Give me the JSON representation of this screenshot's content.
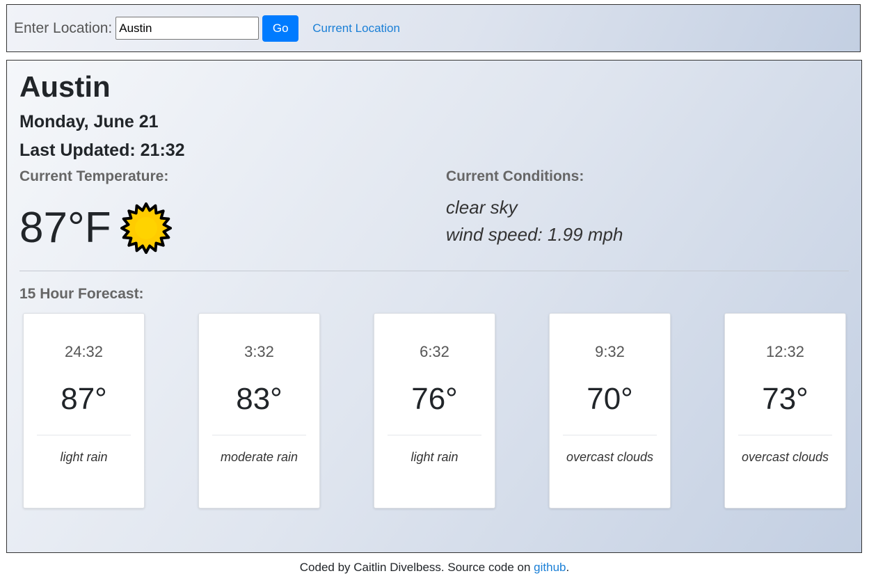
{
  "search": {
    "label": "Enter Location:",
    "value": "Austin",
    "go_label": "Go",
    "current_location_label": "Current Location"
  },
  "weather": {
    "city": "Austin",
    "date": "Monday, June 21",
    "last_updated_label": "Last Updated:",
    "last_updated_time": "21:32",
    "temp_label": "Current Temperature:",
    "current_temp": "87°F",
    "icon": "sun-icon",
    "conditions_label": "Current Conditions:",
    "conditions": "clear sky",
    "wind_label": "wind speed:",
    "wind_value": "1.99 mph"
  },
  "forecast": {
    "label": "15 Hour Forecast:",
    "items": [
      {
        "time": "24:32",
        "temp": "87°",
        "desc": "light rain"
      },
      {
        "time": "3:32",
        "temp": "83°",
        "desc": "moderate rain"
      },
      {
        "time": "6:32",
        "temp": "76°",
        "desc": "light rain"
      },
      {
        "time": "9:32",
        "temp": "70°",
        "desc": "overcast clouds"
      },
      {
        "time": "12:32",
        "temp": "73°",
        "desc": "overcast clouds"
      }
    ]
  },
  "footer": {
    "text_before": "Coded by Caitlin Divelbess. Source code on ",
    "link": "github",
    "text_after": "."
  },
  "colors": {
    "accent": "#007bff",
    "link": "#1a7fd6",
    "sun_fill": "#ffcc00",
    "sun_outline": "#000000"
  }
}
